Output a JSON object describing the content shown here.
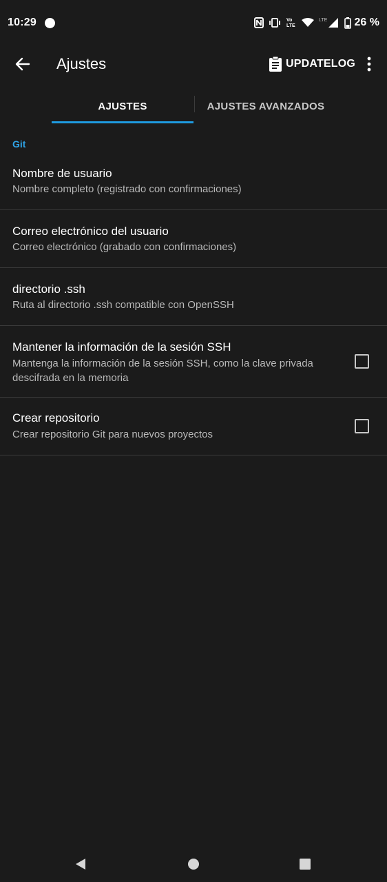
{
  "status_bar": {
    "time": "10:29",
    "battery_text": "26 %",
    "icons": [
      "nfc-icon",
      "vibrate-icon",
      "volte-icon",
      "wifi-icon",
      "lte-signal-icon",
      "battery-icon"
    ],
    "volte_label": "Vo LTE",
    "lte_label": "LTE"
  },
  "app_bar": {
    "title": "Ajustes",
    "updatelog_label": "UPDATELOG"
  },
  "tabs": [
    {
      "label": "AJUSTES",
      "selected": true
    },
    {
      "label": "AJUSTES AVANZADOS",
      "selected": false
    }
  ],
  "colors": {
    "background": "#1b1b1b",
    "accent": "#1e9ae0",
    "section_header": "#2fa3e6",
    "divider": "#3a3a3a"
  },
  "settings": {
    "section_title": "Git",
    "items": [
      {
        "title": "Nombre de usuario",
        "summary": "Nombre completo (registrado con confirmaciones)"
      },
      {
        "title": "Correo electrónico del usuario",
        "summary": "Correo electrónico (grabado con confirmaciones)"
      },
      {
        "title": "directorio .ssh",
        "summary": "Ruta al directorio .ssh compatible con OpenSSH"
      },
      {
        "title": "Mantener la información de la sesión SSH",
        "summary": "Mantenga la información de la sesión SSH, como la clave privada descifrada en la memoria",
        "checked": false
      },
      {
        "title": "Crear repositorio",
        "summary": "Crear repositorio Git para nuevos proyectos",
        "checked": false
      }
    ]
  },
  "nav_bar": {
    "buttons": [
      "back-triangle-icon",
      "home-circle-icon",
      "recents-square-icon"
    ]
  }
}
